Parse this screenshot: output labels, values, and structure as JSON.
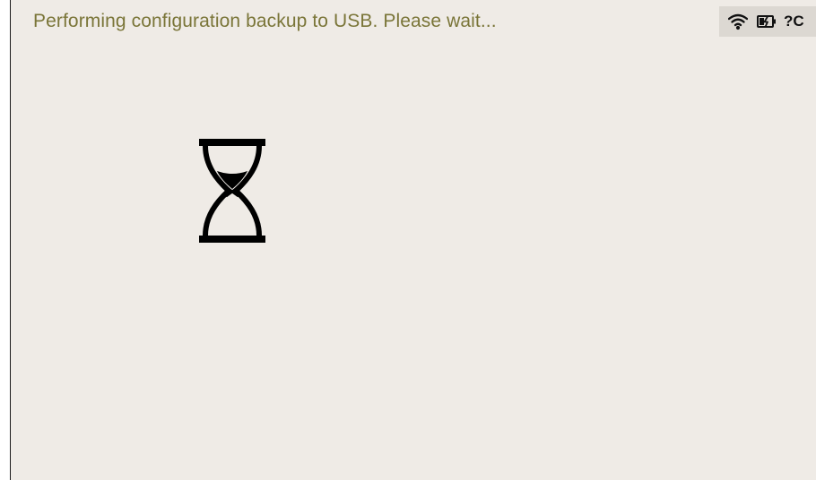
{
  "status": {
    "message": "Performing configuration backup to USB. Please wait..."
  },
  "tray": {
    "wifi_icon": "wifi-icon",
    "battery_icon": "battery-charging-icon",
    "unknown_text": "?C"
  },
  "main": {
    "busy_icon": "hourglass-icon"
  },
  "colors": {
    "background": "#efebe6",
    "message_text": "#7a7538",
    "tray_background": "#dcd8d2",
    "icon": "#111111"
  }
}
